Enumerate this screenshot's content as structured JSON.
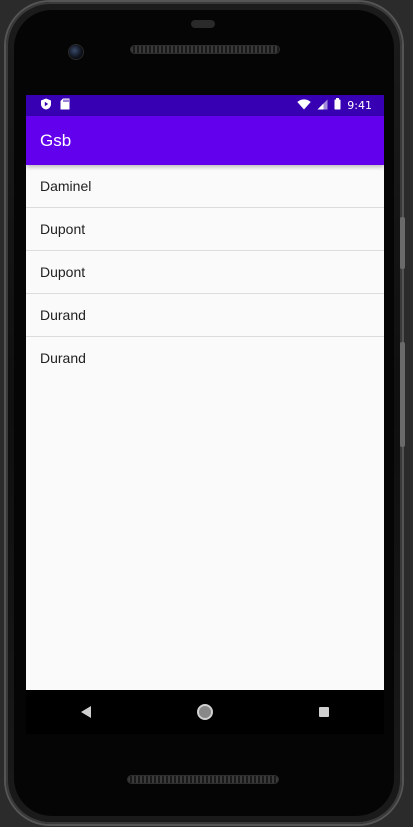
{
  "status_bar": {
    "time": "9:41",
    "icons": {
      "left": [
        "play-protect-icon",
        "sd-card-icon"
      ],
      "right": [
        "wifi-icon",
        "signal-icon",
        "battery-icon"
      ]
    }
  },
  "app_bar": {
    "title": "Gsb"
  },
  "list": {
    "items": [
      {
        "label": "Daminel"
      },
      {
        "label": "Dupont"
      },
      {
        "label": "Dupont"
      },
      {
        "label": "Durand"
      },
      {
        "label": "Durand"
      }
    ]
  },
  "nav_bar": {
    "buttons": [
      "back-icon",
      "home-icon",
      "recents-icon"
    ]
  },
  "colors": {
    "status_bar": "#3700b3",
    "app_bar": "#6200ee",
    "background": "#fafafa"
  }
}
